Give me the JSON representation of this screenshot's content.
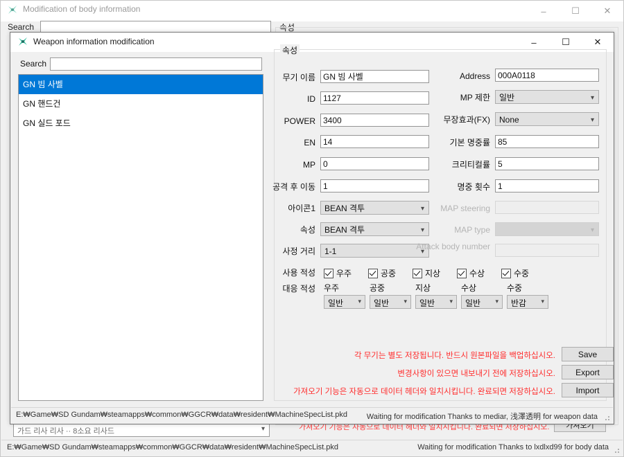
{
  "background_window": {
    "title": "Modification of body information",
    "icon": "app-icon",
    "titlebar_buttons": [
      {
        "name": "minimize-button",
        "glyph": "–"
      },
      {
        "name": "maximize-button",
        "glyph": "☐"
      },
      {
        "name": "close-button",
        "glyph": "✕"
      }
    ],
    "search_label": "Search",
    "search_value": "",
    "group_label": "속성",
    "combo_value": "가드 리사 리사 ·· 8소요 리사드",
    "red_note": "가져오기 기능은 자동으로 데이터 헤더와 일치시킵니다. 완료되면 저장하십시오.",
    "import_button": "가져오기",
    "status_left": "E:₩Game₩SD Gundam₩steamapps₩common₩GGCR₩data₩resident₩MachineSpecList.pkd",
    "status_right": "Waiting for modification   Thanks to lxdlxd99 for body data"
  },
  "dialog": {
    "title": "Weapon information modification",
    "icon": "app-icon",
    "titlebar_buttons": [
      {
        "name": "minimize-button",
        "glyph": "–"
      },
      {
        "name": "maximize-button",
        "glyph": "☐"
      },
      {
        "name": "close-button",
        "glyph": "✕"
      }
    ],
    "search_label": "Search",
    "search_value": "",
    "search_placeholder": "",
    "weapon_list": [
      {
        "label": "GN 빔 사벨",
        "selected": true
      },
      {
        "label": "GN 핸드건",
        "selected": false
      },
      {
        "label": "GN 실드 포드",
        "selected": false
      }
    ],
    "group_label": "속성",
    "left_fields": [
      {
        "name": "weapon-name",
        "label": "무기 이름",
        "value": "GN 빔 사벨",
        "type": "text",
        "disabled": false
      },
      {
        "name": "weapon-id",
        "label": "ID",
        "value": "1127",
        "type": "text",
        "disabled": false
      },
      {
        "name": "weapon-power",
        "label": "POWER",
        "value": "3400",
        "type": "text",
        "disabled": false
      },
      {
        "name": "weapon-en",
        "label": "EN",
        "value": "14",
        "type": "text",
        "disabled": false
      },
      {
        "name": "weapon-mp",
        "label": "MP",
        "value": "0",
        "type": "text",
        "disabled": false
      },
      {
        "name": "move-after-attack",
        "label": "공격 후 이동",
        "value": "1",
        "type": "text",
        "disabled": false
      },
      {
        "name": "icon1",
        "label": "아이콘1",
        "value": "BEAN 격투",
        "type": "combo",
        "disabled": false
      },
      {
        "name": "attribute",
        "label": "속성",
        "value": "BEAN 격투",
        "type": "combo",
        "disabled": false
      },
      {
        "name": "range",
        "label": "사정 거리",
        "value": "1-1",
        "type": "combo",
        "disabled": false
      }
    ],
    "right_fields": [
      {
        "name": "address",
        "label": "Address",
        "value": "000A0118",
        "type": "text",
        "disabled": false
      },
      {
        "name": "mp-limit",
        "label": "MP 제한",
        "value": "일반",
        "type": "combo",
        "disabled": false
      },
      {
        "name": "weapon-fx",
        "label": "무장효과(FX)",
        "value": "None",
        "type": "combo",
        "disabled": false
      },
      {
        "name": "base-accuracy",
        "label": "기본 명중률",
        "value": "85",
        "type": "text",
        "disabled": false
      },
      {
        "name": "critical-rate",
        "label": "크리티컬률",
        "value": "5",
        "type": "text",
        "disabled": false
      },
      {
        "name": "hit-count",
        "label": "명중 횟수",
        "value": "1",
        "type": "text",
        "disabled": false
      },
      {
        "name": "map-steering",
        "label": "MAP steering",
        "value": "",
        "type": "text",
        "disabled": true
      },
      {
        "name": "map-type",
        "label": "MAP type",
        "value": "",
        "type": "combo",
        "disabled": true
      },
      {
        "name": "attack-body-number",
        "label": "Attack body number",
        "value": "",
        "type": "text",
        "disabled": true
      }
    ],
    "usage_aptitude": {
      "label": "사용 적성",
      "items": [
        {
          "name": "space",
          "label": "우주",
          "checked": true
        },
        {
          "name": "air",
          "label": "공중",
          "checked": true
        },
        {
          "name": "ground",
          "label": "지상",
          "checked": true
        },
        {
          "name": "water-surface",
          "label": "수상",
          "checked": true
        },
        {
          "name": "underwater",
          "label": "수중",
          "checked": true
        }
      ]
    },
    "response_aptitude": {
      "label": "대응 적성",
      "items": [
        {
          "name": "space",
          "header": "우주",
          "value": "일반"
        },
        {
          "name": "air",
          "header": "공중",
          "value": "일반"
        },
        {
          "name": "ground",
          "header": "지상",
          "value": "일반"
        },
        {
          "name": "water-surface",
          "header": "수상",
          "value": "일반"
        },
        {
          "name": "underwater",
          "header": "수중",
          "value": "반감"
        }
      ]
    },
    "notes": [
      "각 무기는 별도 저장됩니다. 반드시 원본파일을 백업하십시오.",
      "변경사항이 있으면 내보내기 전에 저장하십시오.",
      "가져오기 기능은 자동으로 데이터 헤더와 일치시킵니다. 완료되면 저장하십시오."
    ],
    "action_buttons": [
      {
        "name": "save-button",
        "label": "Save"
      },
      {
        "name": "export-button",
        "label": "Export"
      },
      {
        "name": "import-button",
        "label": "Import"
      }
    ],
    "status_left": "E:₩Game₩SD Gundam₩steamapps₩common₩GGCR₩data₩resident₩MachineSpecList.pkd",
    "status_right": "Waiting for modification   Thanks to mediar, 浅澤透明 for weapon data"
  },
  "colors": {
    "selection": "#0078d7",
    "warning_red": "#ff2b2b",
    "window_bg": "#f0f0f0",
    "disabled_text": "#b5b5b5"
  }
}
